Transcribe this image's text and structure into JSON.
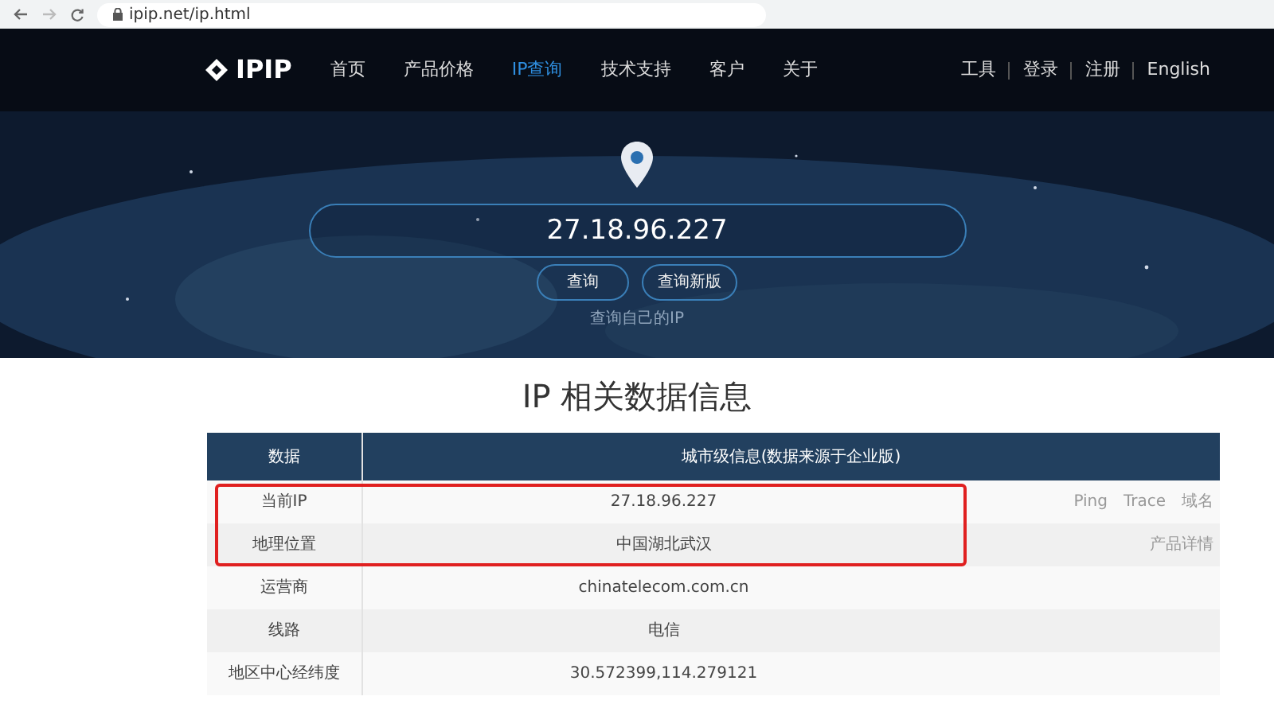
{
  "browser": {
    "url": "ipip.net/ip.html"
  },
  "nav": {
    "logo": "IPIP",
    "items": [
      {
        "label": "首页",
        "selected": false
      },
      {
        "label": "产品价格",
        "selected": false
      },
      {
        "label": "IP查询",
        "selected": true
      },
      {
        "label": "技术支持",
        "selected": false
      },
      {
        "label": "客户",
        "selected": false
      },
      {
        "label": "关于",
        "selected": false
      }
    ],
    "right": [
      "工具",
      "登录",
      "注册",
      "English"
    ]
  },
  "search": {
    "value": "27.18.96.227",
    "buttons": [
      "查询",
      "查询新版"
    ],
    "self_link": "查询自己的IP"
  },
  "title": "IP 相关数据信息",
  "table": {
    "columns": [
      "数据",
      "城市级信息(数据来源于企业版)"
    ],
    "rows": [
      {
        "label": "当前IP",
        "value": "27.18.96.227",
        "links": [
          "Ping",
          "Trace",
          "域名"
        ],
        "highlighted": true
      },
      {
        "label": "地理位置",
        "value": "中国湖北武汉",
        "links": [
          "产品详情"
        ],
        "highlighted": true
      },
      {
        "label": "运营商",
        "value": "chinatelecom.com.cn",
        "highlighted": false
      },
      {
        "label": "线路",
        "value": "电信",
        "highlighted": false
      },
      {
        "label": "地区中心经纬度",
        "value": "30.572399,114.279121",
        "highlighted": false
      }
    ]
  }
}
